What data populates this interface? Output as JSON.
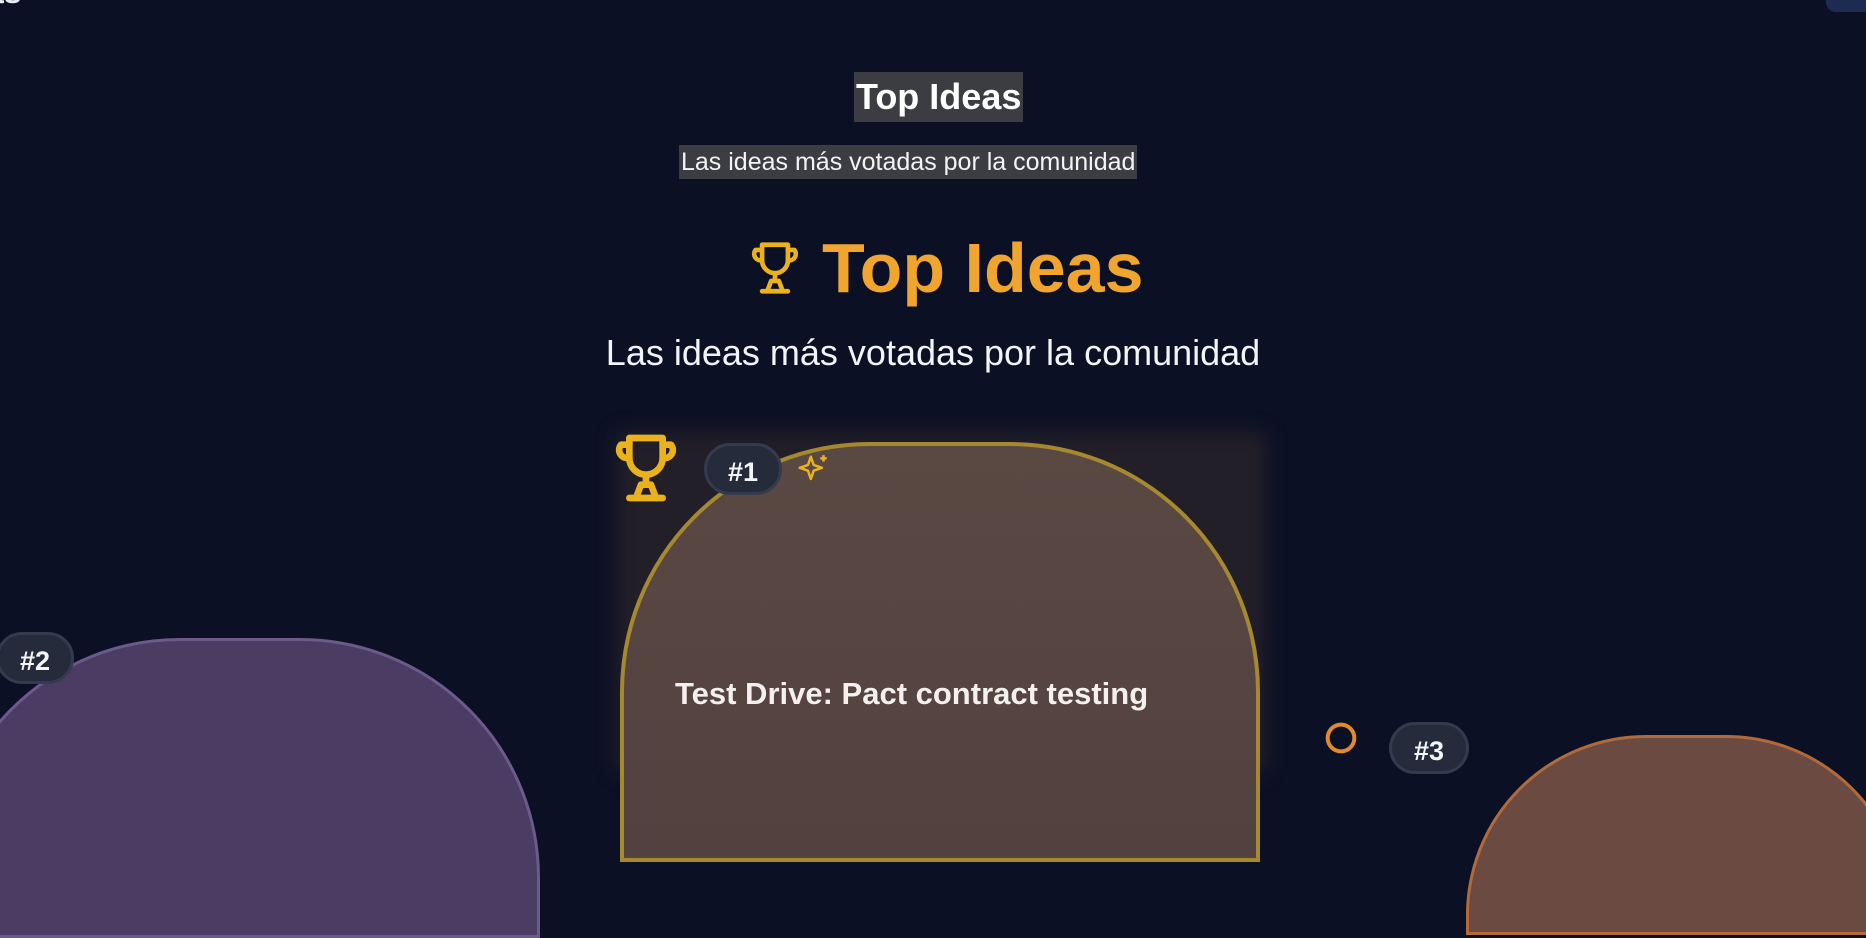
{
  "top_fragment": {
    "text": "as"
  },
  "header": {
    "title": "Top Ideas",
    "subtitle": "Las ideas más votadas por la comunidad"
  },
  "main": {
    "heading": "Top Ideas",
    "subheading": "Las ideas más votadas por la comunidad"
  },
  "cards": [
    {
      "rank": "#1",
      "title": "Test Drive: Pact contract testing"
    },
    {
      "rank": "#2"
    },
    {
      "rank": "#3"
    }
  ],
  "colors": {
    "background": "#0b1024",
    "accent": "#efa52e",
    "trophy": "#eab21f",
    "card1_border": "#a6882f"
  },
  "icons": {
    "heading": "trophy-icon",
    "card1": "trophy-icon",
    "sparkle": "sparkles-icon",
    "card3": "medal-icon"
  }
}
